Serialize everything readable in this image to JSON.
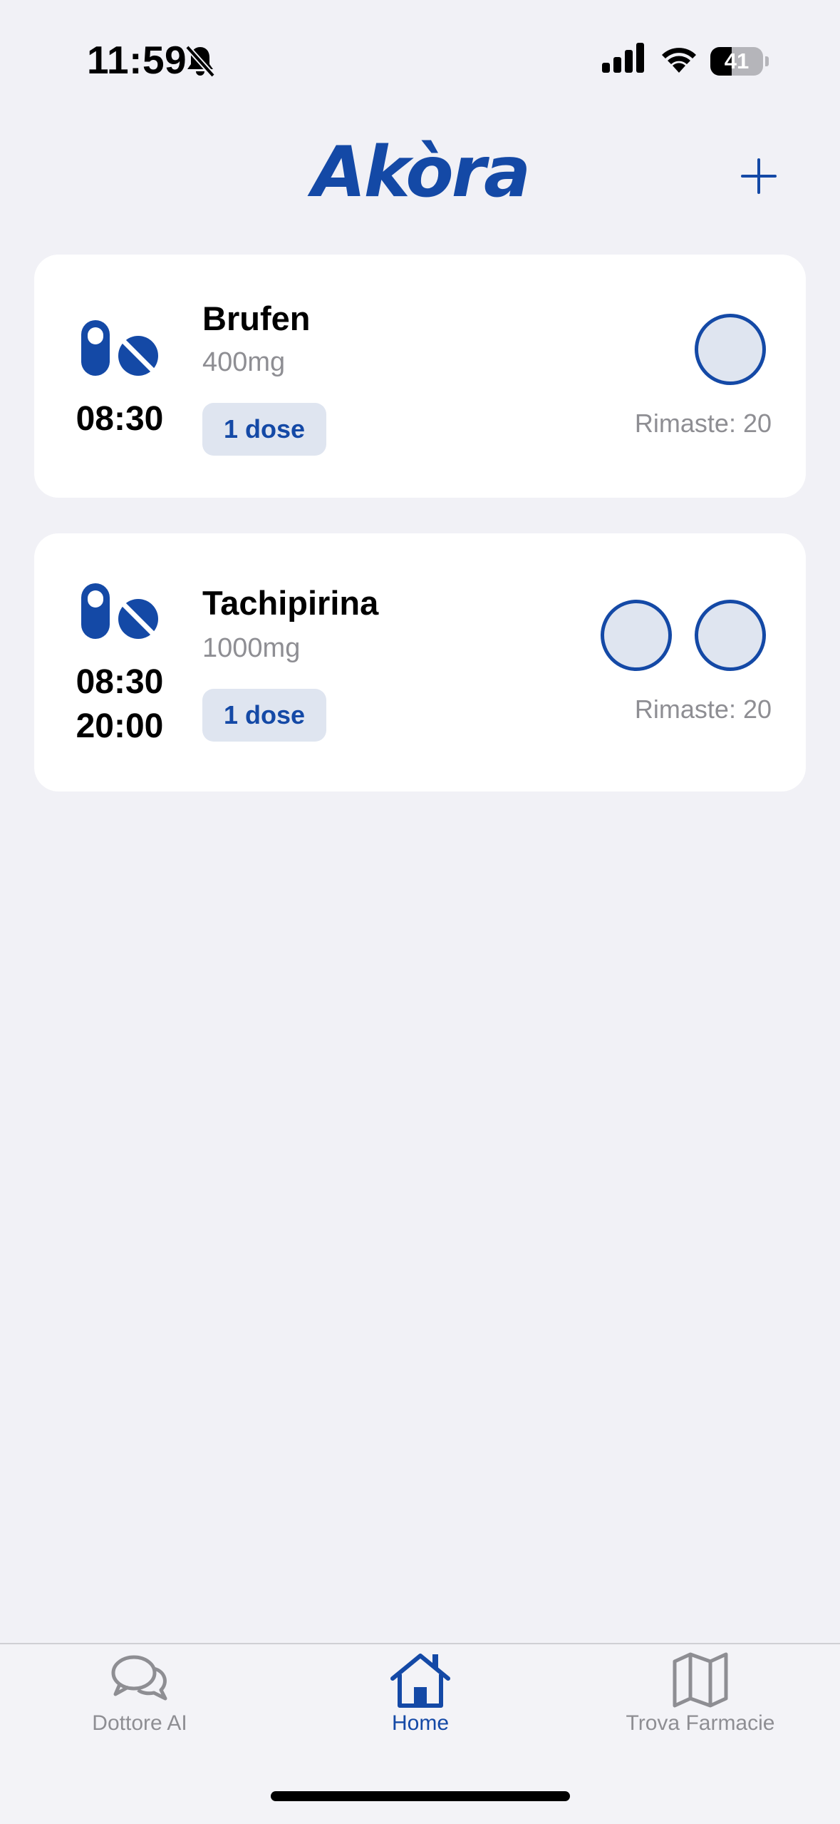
{
  "status_bar": {
    "time": "11:59",
    "battery": "41",
    "battery_level": 0.41
  },
  "header": {
    "logo": "Akòra",
    "add_icon": "plus-icon"
  },
  "medications": [
    {
      "name": "Brufen",
      "dose": "400mg",
      "times": [
        "08:30"
      ],
      "chip": "1 dose",
      "remaining": "Rimaste: 20",
      "dose_slots": 1
    },
    {
      "name": "Tachipirina",
      "dose": "1000mg",
      "times": [
        "08:30",
        "20:00"
      ],
      "chip": "1 dose",
      "remaining": "Rimaste: 20",
      "dose_slots": 2
    }
  ],
  "tabbar": {
    "tabs": [
      {
        "label": "Dottore AI",
        "icon": "chat-bubbles-icon",
        "active": false
      },
      {
        "label": "Home",
        "icon": "house-icon",
        "active": true
      },
      {
        "label": "Trova Farmacie",
        "icon": "map-icon",
        "active": false
      }
    ]
  },
  "colors": {
    "accent": "#1449a6",
    "background": "#f1f1f6",
    "chip_bg": "#dfe5f0",
    "muted": "#8e8e93"
  }
}
